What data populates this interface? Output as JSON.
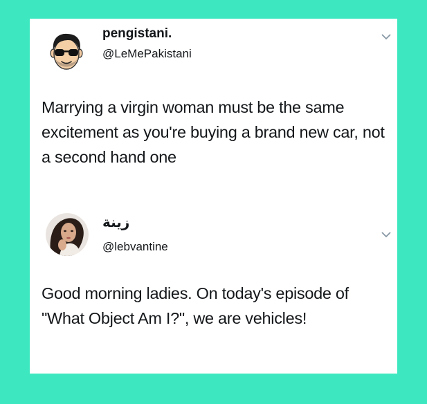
{
  "colors": {
    "background": "#3de8c0",
    "card": "#ffffff",
    "text": "#14171a",
    "chevron": "#8899a6"
  },
  "tweets": [
    {
      "display_name": "pengistani.",
      "handle": "@LeMePakistani",
      "text": "Marrying a virgin woman must be the same excitement as you're buying a brand new car, not a second hand one",
      "avatar_icon": "cartoon-man-sunglasses-avatar",
      "menu_icon": "chevron-down-icon"
    },
    {
      "display_name": "زينة",
      "handle": "@lebvantine",
      "text": "Good morning ladies. On today's episode of \"What Object Am I?\", we are vehicles!",
      "avatar_icon": "woman-photo-avatar",
      "menu_icon": "chevron-down-icon"
    }
  ]
}
